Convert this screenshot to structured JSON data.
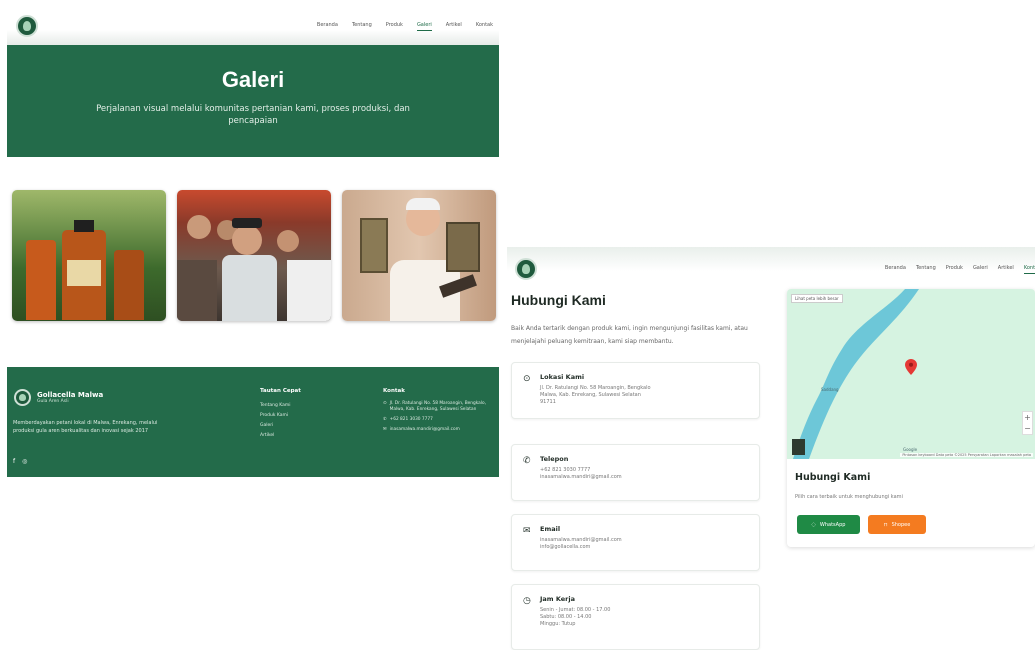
{
  "colors": {
    "brand_green": "#236b4a",
    "accent_orange": "#f47b20",
    "whatsapp_green": "#1f8a45"
  },
  "left": {
    "nav": [
      "Beranda",
      "Tentang",
      "Produk",
      "Galeri",
      "Artikel",
      "Kontak"
    ],
    "active_nav": "Galeri",
    "hero": {
      "title": "Galeri",
      "subtitle": "Perjalanan visual melalui komunitas pertanian kami, proses produksi, dan pencapaian"
    },
    "footer": {
      "brand_name": "Gollacella Malwa",
      "brand_sub": "Gula Aren Asli",
      "description": "Memberdayakan petani lokal di Malwa, Enrekang, melalui produksi gula aren berkualitas dan inovasi sejak 2017",
      "links_title": "Tautan Cepat",
      "links": [
        "Tentang Kami",
        "Produk Kami",
        "Galeri",
        "Artikel"
      ],
      "contact_title": "Kontak",
      "address": "Jl. Dr. Ratulangi No. 58 Maroangin, Bengkalo, Malwa, Kab. Enrekang, Sulawesi Selatan",
      "phone": "+62 821 3030 7777",
      "email": "inasamalwa.mandiri@gmail.com"
    }
  },
  "right": {
    "nav": [
      "Beranda",
      "Tentang",
      "Produk",
      "Galeri",
      "Artikel",
      "Kontak"
    ],
    "active_nav": "Kontak",
    "title": "Hubungi Kami",
    "intro": "Baik Anda tertarik dengan produk kami, ingin mengunjungi fasilitas kami, atau menjelajahi peluang kemitraan, kami siap membantu.",
    "cards": [
      {
        "title": "Lokasi Kami",
        "lines": [
          "Jl. Dr. Ratulangi No. 58 Maroangin, Bengkalo",
          "Malwa, Kab. Enrekang, Sulawesi Selatan",
          "91711"
        ]
      },
      {
        "title": "Telepon",
        "lines": [
          "+62 821 3030 7777",
          "inasamalwa.mandiri@gmail.com"
        ]
      },
      {
        "title": "Email",
        "lines": [
          "inasamalwa.mandiri@gmail.com",
          "info@gollacella.com"
        ]
      },
      {
        "title": "Jam Kerja",
        "lines": [
          "Senin - Jumat: 08.00 - 17.00",
          "Sabtu: 08.00 - 14.00",
          "Minggu: Tutup"
        ]
      }
    ],
    "map": {
      "view_label": "Lihat peta lebih besar",
      "place_label": "Saddang",
      "logo_label": "Google",
      "zoom_in": "+",
      "zoom_out": "−",
      "attribution": "Pintasan keyboard   Data peta ©2025   Persyaratan   Laporkan masalah peta"
    },
    "contact_box": {
      "title": "Hubungi Kami",
      "subtitle": "Pilih cara terbaik untuk menghubungi kami",
      "whatsapp_label": "WhatsApp",
      "shopee_label": "Shopee"
    }
  }
}
